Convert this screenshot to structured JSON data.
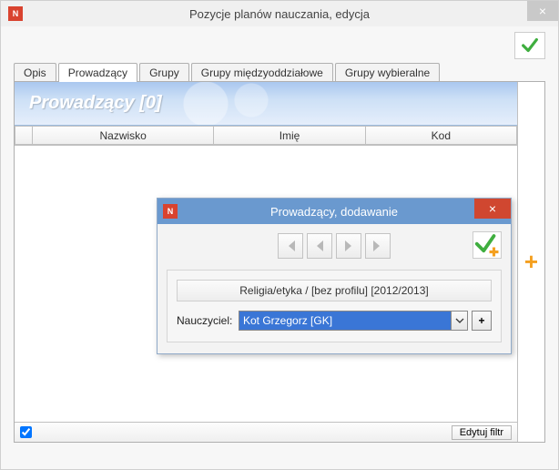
{
  "window": {
    "title": "Pozycje planów nauczania, edycja"
  },
  "tabs": {
    "items": [
      {
        "label": "Opis"
      },
      {
        "label": "Prowadzący"
      },
      {
        "label": "Grupy"
      },
      {
        "label": "Grupy międzyoddziałowe"
      },
      {
        "label": "Grupy wybieralne"
      }
    ],
    "active_index": 1
  },
  "band": {
    "title": "Prowadzący [0]"
  },
  "grid": {
    "columns": [
      {
        "label": "Nazwisko"
      },
      {
        "label": "Imię"
      },
      {
        "label": "Kod"
      }
    ],
    "footer": {
      "edit_filter": "Edytuj filtr",
      "checkbox_checked": true
    }
  },
  "dialog": {
    "title": "Prowadzący, dodawanie",
    "subject": "Religia/etyka / [bez profilu] [2012/2013]",
    "teacher_label": "Nauczyciel:",
    "teacher_value": "Kot Grzegorz [GK]"
  },
  "icons": {
    "check": "check",
    "plus": "+",
    "close": "×"
  }
}
